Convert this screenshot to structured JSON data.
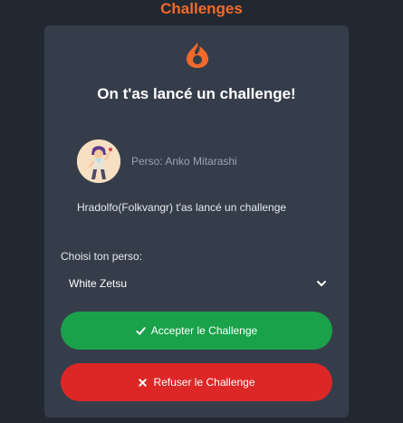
{
  "header": {
    "title": "Challenges"
  },
  "card": {
    "title": "On t'as lancé un challenge!",
    "challenger_perso": "Perso: Anko Mitarashi",
    "message": "Hradolfo(Folkvangr) t'as lancé un challenge"
  },
  "form": {
    "select_label": "Choisi ton perso:",
    "selected_perso": "White Zetsu"
  },
  "actions": {
    "accept_label": "Accepter le Challenge",
    "refuse_label": "Refuser le Challenge"
  },
  "colors": {
    "accent": "#f16a2a",
    "card_bg": "#363d4a",
    "page_bg": "#222831",
    "accept": "#1aa24a",
    "refuse": "#dd2727"
  },
  "icons": [
    "fire-icon",
    "checkmark-icon",
    "close-icon",
    "chevron-down-icon"
  ]
}
